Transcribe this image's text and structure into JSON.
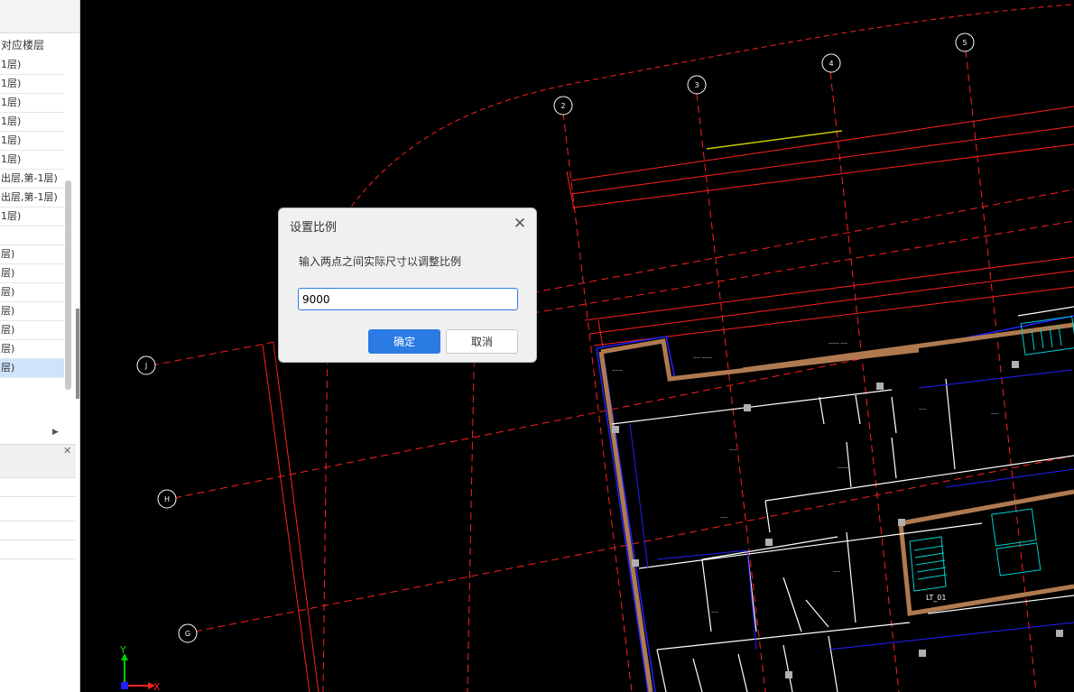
{
  "left_panel": {
    "column_header": "对应楼层",
    "rows": [
      "1层)",
      "1层)",
      "1层)",
      "1层)",
      "1层)",
      "1层)",
      "出层,第-1层)",
      "出层,第-1层)",
      "1层)",
      "",
      "层)",
      "层)",
      "层)",
      "层)",
      "层)",
      "层)",
      "层)"
    ],
    "selected_row_index": 16
  },
  "cad": {
    "axis_labels": [
      "2",
      "3",
      "4",
      "5",
      "J",
      "H",
      "G"
    ],
    "stair_label": "LT_01",
    "ucs": {
      "y": "Y",
      "x": "X"
    },
    "colors": {
      "background": "#000000",
      "grid": "#ff2020",
      "walls": "#ffffff",
      "outline": "#2020ff",
      "ucs_y": "#00cc00",
      "ucs_x": "#ff2020"
    }
  },
  "dialog": {
    "title": "设置比例",
    "message": "输入两点之间实际尺寸以调整比例",
    "input_value": "9000",
    "ok_label": "确定",
    "cancel_label": "取消",
    "close_icon": "close-icon"
  }
}
